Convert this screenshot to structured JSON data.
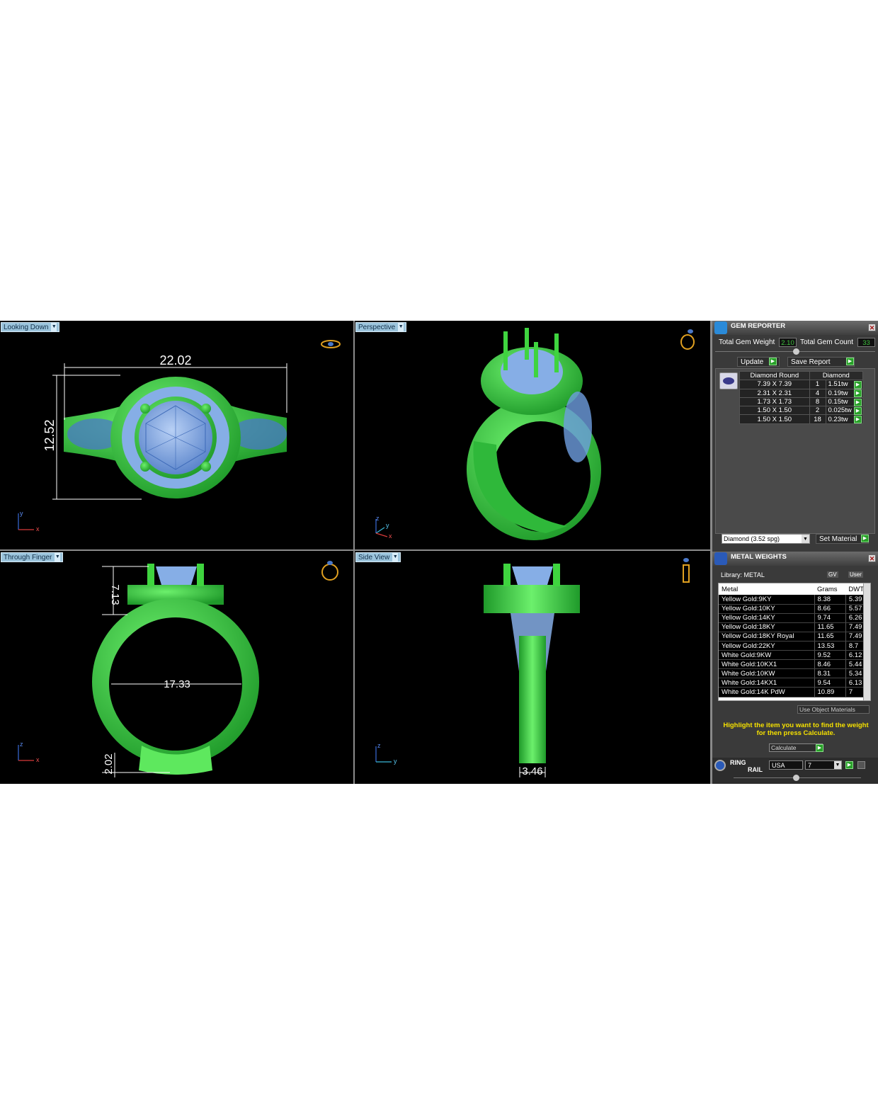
{
  "viewports": {
    "top_left": {
      "label": "Looking Down",
      "dims": {
        "width": "22.02",
        "height": "12.52"
      },
      "axes": [
        "y",
        "x"
      ]
    },
    "top_right": {
      "label": "Perspective",
      "axes": [
        "z",
        "y",
        "x"
      ]
    },
    "bottom_left": {
      "label": "Through Finger",
      "dims": {
        "top": "7.13",
        "inner": "17.33",
        "bottom": "2.02"
      },
      "axes": [
        "z",
        "x"
      ]
    },
    "bottom_right": {
      "label": "Side View",
      "dims": {
        "width": "3.46"
      },
      "axes": [
        "z",
        "y"
      ]
    }
  },
  "gem_reporter": {
    "title": "GEM REPORTER",
    "total_weight_label": "Total Gem Weight",
    "total_weight": "2.10",
    "total_count_label": "Total Gem Count",
    "total_count": "33",
    "update_label": "Update",
    "save_label": "Save Report",
    "table_header": [
      "Diamond Round",
      "Diamond"
    ],
    "rows": [
      {
        "size": "7.39 X 7.39",
        "count": "1",
        "weight": "1.51tw"
      },
      {
        "size": "2.31 X 2.31",
        "count": "4",
        "weight": "0.19tw"
      },
      {
        "size": "1.73 X 1.73",
        "count": "8",
        "weight": "0.15tw"
      },
      {
        "size": "1.50 X 1.50",
        "count": "2",
        "weight": "0.025tw"
      },
      {
        "size": "1.50 X 1.50",
        "count": "18",
        "weight": "0.23tw"
      }
    ],
    "material_select": "Diamond      (3.52 spg)",
    "set_material_label": "Set Material"
  },
  "metal_weights": {
    "title": "METAL WEIGHTS",
    "library_label": "Library: METAL",
    "gv_label": "GV",
    "user_label": "User",
    "columns": [
      "Metal",
      "Grams",
      "DWT"
    ],
    "rows": [
      {
        "metal": "Yellow Gold:9KY",
        "grams": "8.38",
        "dwt": "5.39"
      },
      {
        "metal": "Yellow Gold:10KY",
        "grams": "8.66",
        "dwt": "5.57"
      },
      {
        "metal": "Yellow Gold:14KY",
        "grams": "9.74",
        "dwt": "6.26"
      },
      {
        "metal": "Yellow Gold:18KY",
        "grams": "11.65",
        "dwt": "7.49"
      },
      {
        "metal": "Yellow Gold:18KY Royal",
        "grams": "11.65",
        "dwt": "7.49"
      },
      {
        "metal": "Yellow Gold:22KY",
        "grams": "13.53",
        "dwt": "8.7"
      },
      {
        "metal": "White Gold:9KW",
        "grams": "9.52",
        "dwt": "6.12"
      },
      {
        "metal": "White Gold:10KX1",
        "grams": "8.46",
        "dwt": "5.44"
      },
      {
        "metal": "White Gold:10KW",
        "grams": "8.31",
        "dwt": "5.34"
      },
      {
        "metal": "White Gold:14KX1",
        "grams": "9.54",
        "dwt": "6.13"
      },
      {
        "metal": "White Gold:14K PdW",
        "grams": "10.89",
        "dwt": "7"
      }
    ],
    "use_object_label": "Use Object Materials",
    "hint": "Highlight the item you want to find the weight for then press Calculate.",
    "calculate_label": "Calculate"
  },
  "ring_rail": {
    "title_line1": "RING",
    "title_line2": "RAIL",
    "region": "USA",
    "size": "7"
  },
  "colors": {
    "metal": "#3fd43f",
    "gem": "#7da8e0",
    "dimension": "#ffffff",
    "accent": "#28a028"
  }
}
